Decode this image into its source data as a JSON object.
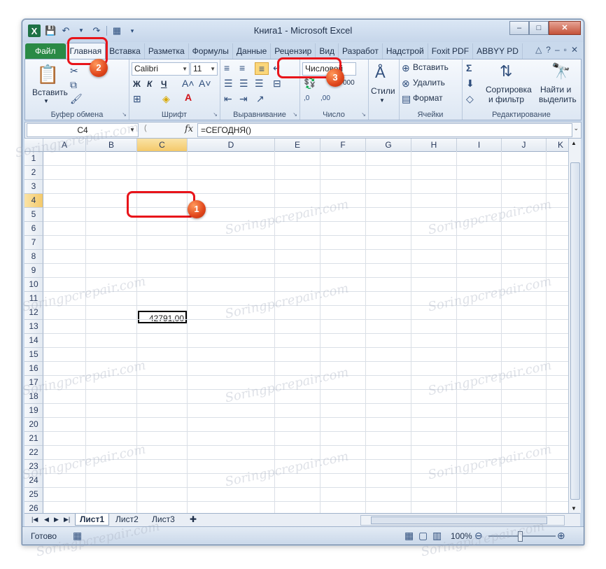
{
  "window": {
    "title": "Книга1 - Microsoft Excel",
    "logo": "X",
    "minimize": "–",
    "maximize": "□",
    "close": "✕"
  },
  "tabs": [
    "Файл",
    "Главная",
    "Вставка",
    "Разметка",
    "Формулы",
    "Данные",
    "Рецензир",
    "Вид",
    "Разработ",
    "Надстрой",
    "Foxit PDF",
    "ABBYY PD"
  ],
  "ribbon": {
    "clipboard": {
      "label": "Буфер обмена",
      "paste": "Вставить"
    },
    "font": {
      "label": "Шрифт",
      "name": "Calibri",
      "size": "11",
      "bold": "Ж",
      "italic": "К",
      "underline": "Ч"
    },
    "alignment": {
      "label": "Выравнивание"
    },
    "number": {
      "label": "Число",
      "format": "Числовой",
      "percent": "%",
      "thousands": "000"
    },
    "styles": {
      "label": "Стили"
    },
    "cells": {
      "label": "Ячейки",
      "insert": "Вставить",
      "delete": "Удалить",
      "format": "Формат"
    },
    "editing": {
      "label": "Редактирование",
      "sort1": "Сортировка",
      "sort2": "и фильтр",
      "find1": "Найти и",
      "find2": "выделить"
    }
  },
  "formula_bar": {
    "name_box": "C4",
    "fx": "fx",
    "formula": "=СЕГОДНЯ()"
  },
  "grid": {
    "columns": [
      "A",
      "B",
      "C",
      "D",
      "E",
      "F",
      "G",
      "H",
      "I",
      "J",
      "K"
    ],
    "rows": [
      "1",
      "2",
      "3",
      "4",
      "5",
      "6",
      "7",
      "8",
      "9",
      "10",
      "11",
      "12",
      "13",
      "14",
      "15",
      "16",
      "17",
      "18",
      "19",
      "20",
      "21",
      "22",
      "23",
      "24",
      "25",
      "26"
    ],
    "selected_cell_value": "42791,00"
  },
  "sheets": [
    "Лист1",
    "Лист2",
    "Лист3"
  ],
  "status": {
    "ready": "Готово",
    "zoom": "100%"
  },
  "annotations": [
    "1",
    "2",
    "3"
  ],
  "watermark": "Soringpcrepair.com"
}
